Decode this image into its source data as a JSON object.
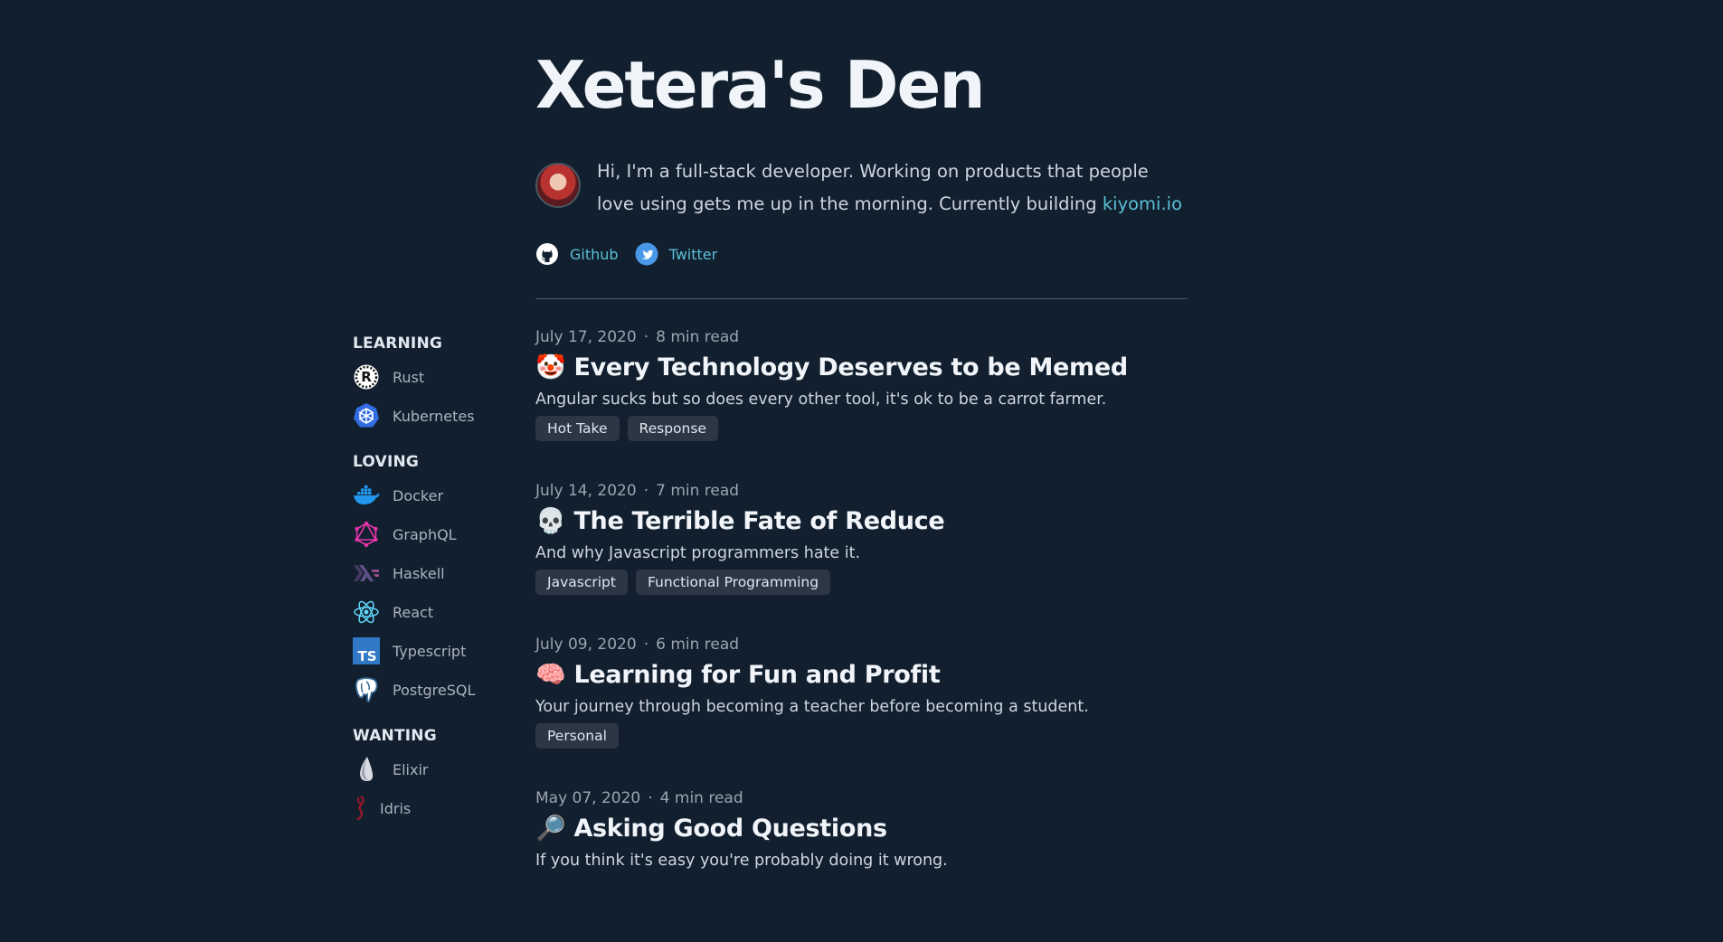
{
  "site": {
    "title": "Xetera's Den",
    "bio_text": "Hi, I'm a full-stack developer. Working on products that people love using gets me up in the morning. Currently building ",
    "bio_link": "kiyomi.io"
  },
  "social": [
    {
      "label": "Github",
      "icon": "github-icon"
    },
    {
      "label": "Twitter",
      "icon": "twitter-icon"
    }
  ],
  "sidebar": {
    "learning": {
      "heading": "LEARNING",
      "items": [
        "Rust",
        "Kubernetes"
      ]
    },
    "loving": {
      "heading": "LOVING",
      "items": [
        "Docker",
        "GraphQL",
        "Haskell",
        "React",
        "Typescript",
        "PostgreSQL"
      ]
    },
    "wanting": {
      "heading": "WANTING",
      "items": [
        "Elixir",
        "Idris"
      ]
    }
  },
  "posts": [
    {
      "date": "July 17, 2020",
      "read_time": "8 min read",
      "emoji": "🤡",
      "title": "Every Technology Deserves to be Memed",
      "description": "Angular sucks but so does every other tool, it's ok to be a carrot farmer.",
      "tags": [
        "Hot Take",
        "Response"
      ]
    },
    {
      "date": "July 14, 2020",
      "read_time": "7 min read",
      "emoji": "💀",
      "title": "The Terrible Fate of Reduce",
      "description": "And why Javascript programmers hate it.",
      "tags": [
        "Javascript",
        "Functional Programming"
      ]
    },
    {
      "date": "July 09, 2020",
      "read_time": "6 min read",
      "emoji": "🧠",
      "title": "Learning for Fun and Profit",
      "description": "Your journey through becoming a teacher before becoming a student.",
      "tags": [
        "Personal"
      ]
    },
    {
      "date": "May 07, 2020",
      "read_time": "4 min read",
      "emoji": "🔎",
      "title": "Asking Good Questions",
      "description": "If you think it's easy you're probably doing it wrong.",
      "tags": []
    }
  ],
  "meta_separator": "·",
  "colors": {
    "background": "#111f2e",
    "link": "#5bc0d6",
    "tag_bg": "#2c3644"
  }
}
